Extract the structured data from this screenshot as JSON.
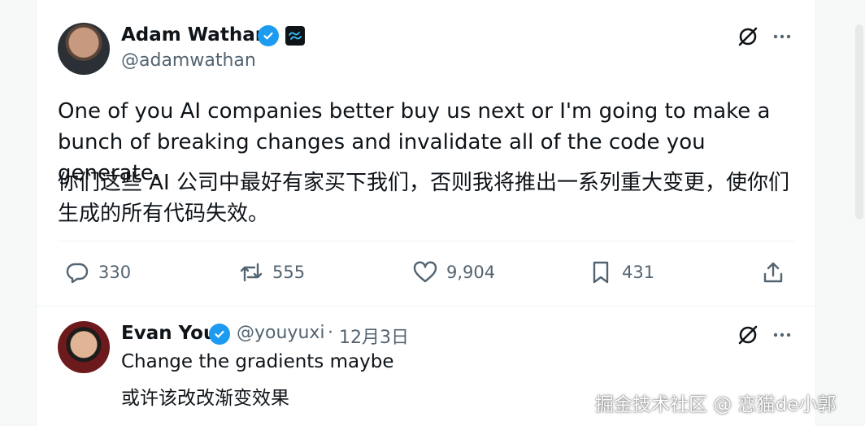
{
  "tweet": {
    "author_name": "Adam Wathan",
    "author_handle": "@adamwathan",
    "text_en": "One of you AI companies better buy us next or I'm going to make a bunch of breaking changes and invalidate all of the code you generate.",
    "text_zh": "你们这些 AI 公司中最好有家买下我们，否则我将推出一系列重大变更，使你们生成的所有代码失效。",
    "stats": {
      "replies": "330",
      "reposts": "555",
      "likes": "9,904",
      "bookmarks": "431"
    }
  },
  "reply": {
    "author_name": "Evan You",
    "author_handle": "@youyuxi",
    "separator": "·",
    "date": "12月3日",
    "text_en": "Change the gradients maybe",
    "text_zh": "或许该改改渐变效果"
  },
  "watermark": "掘金技术社区 @ 恋猫de小郭",
  "colors": {
    "verified_blue": "#1d9bf0",
    "text_primary": "#0f1419",
    "text_secondary": "#536471"
  },
  "icons": [
    "verified-icon",
    "tailwind-affiliate-icon",
    "grok-icon",
    "more-icon",
    "reply-icon",
    "repost-icon",
    "like-icon",
    "bookmark-icon",
    "share-icon"
  ]
}
